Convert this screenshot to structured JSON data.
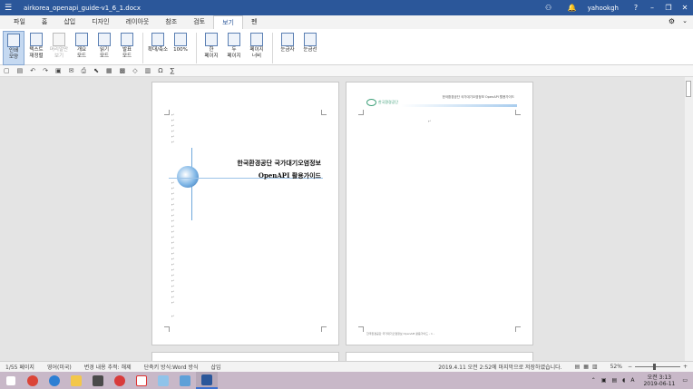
{
  "window": {
    "title": "airkorea_openapi_guide-v1_6_1.docx",
    "user": "yahookgh",
    "help": "?",
    "minimize": "–",
    "restore": "❐",
    "close": "✕"
  },
  "tabs": [
    "파일",
    "홈",
    "삽입",
    "디자인",
    "레이아웃",
    "참조",
    "검토",
    "보기",
    "펜"
  ],
  "active_tab": "보기",
  "ribbon": {
    "buttons": [
      {
        "label": "인쇄\n모양",
        "active": true,
        "disabled": false
      },
      {
        "label": "텍스트\n재정렬",
        "active": false,
        "disabled": false
      },
      {
        "label": "머리말만\n보기",
        "active": false,
        "disabled": true
      },
      {
        "label": "개요\n모드",
        "active": false,
        "disabled": false
      },
      {
        "label": "읽기\n모드",
        "active": false,
        "disabled": false
      },
      {
        "label": "발표\n모드",
        "active": false,
        "disabled": false
      },
      {
        "label": "확대/축소",
        "active": false,
        "disabled": false
      },
      {
        "label": "100%",
        "active": false,
        "disabled": false
      },
      {
        "label": "한\n페이지",
        "active": false,
        "disabled": false
      },
      {
        "label": "두\n페이지",
        "active": false,
        "disabled": false
      },
      {
        "label": "페이지\n너비",
        "active": false,
        "disabled": false
      },
      {
        "label": "눈금자",
        "active": false,
        "disabled": false
      },
      {
        "label": "눈금선",
        "active": false,
        "disabled": false
      }
    ]
  },
  "cover": {
    "title_line1": "한국환경공단 국가대기오염정보",
    "title_line2": "OpenAPI 활용가이드"
  },
  "page2": {
    "header_text": "한국환경공단 국가대기오염정보 OpenAPI 활용가이드",
    "logo_text": "한국환경공단",
    "footer_text": "한국환경공단 국가대기오염정보 OpenAPI 활용가이드 - 1 -"
  },
  "status": {
    "page": "1/55 페이지",
    "language": "영어(미국)",
    "track": "변경 내용 추적: 해제",
    "shortcut": "단축키 방식:Word 방식",
    "insert": "삽입",
    "saved": "2019.4.11 오전 2:52에 마지막으로 저장하였습니다.",
    "zoom": "52%"
  },
  "clock": {
    "time": "오전 3:13",
    "date": "2019-06-11"
  },
  "icons": {
    "menu": "hamburger-icon",
    "gear": "gear-icon",
    "bell": "bell-icon",
    "people": "people-icon"
  },
  "colors": {
    "titlebar": "#2b579a",
    "taskbar": "#c8b8c8",
    "accent": "#2b579a"
  }
}
